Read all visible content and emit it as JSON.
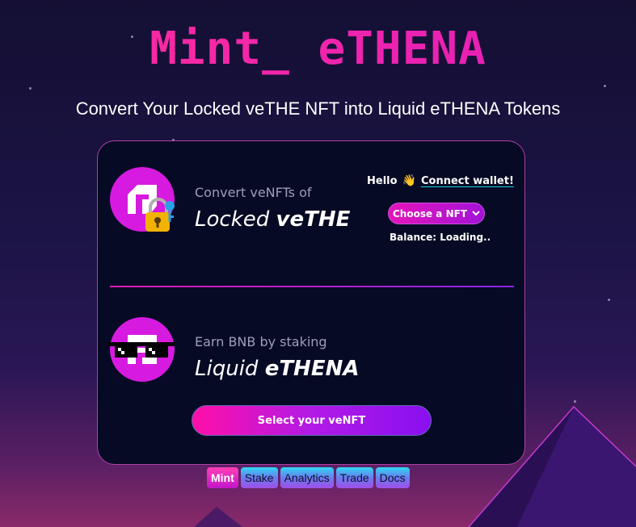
{
  "app": {
    "logo_text": "Mint_ eTHENA",
    "subtitle": "Convert Your Locked veTHE NFT into Liquid eTHENA Tokens"
  },
  "lock_section": {
    "small_label": "Convert veNFTs of",
    "big_label_light": "Locked ",
    "big_label_bold": "veTHE",
    "avatar_icon": "thena-logo-icon",
    "badge_icon": "lock-with-key-emoji"
  },
  "wallet": {
    "hello": "Hello",
    "wave_emoji": "👋",
    "connect_label": "Connect wallet!",
    "nft_select_value": "Choose a NFT",
    "balance_text": "Balance: Loading.."
  },
  "liquid_section": {
    "small_label": "Earn BNB by staking",
    "big_label_light": "Liquid ",
    "big_label_bold": "eTHENA",
    "avatar_icon": "ethena-logo-icon",
    "badge_icon": "pixel-sunglasses-icon"
  },
  "cta": {
    "label": "Select your veNFT"
  },
  "nav": {
    "tabs": [
      {
        "label": "Mint",
        "active": true
      },
      {
        "label": "Stake",
        "active": false
      },
      {
        "label": "Analytics",
        "active": false
      },
      {
        "label": "Trade",
        "active": false
      },
      {
        "label": "Docs",
        "active": false
      }
    ]
  },
  "colors": {
    "accent_pink": "#e514b9",
    "accent_purple": "#8a0ff0",
    "card_bg": "#060a24",
    "link_underline": "#19d3e8"
  }
}
